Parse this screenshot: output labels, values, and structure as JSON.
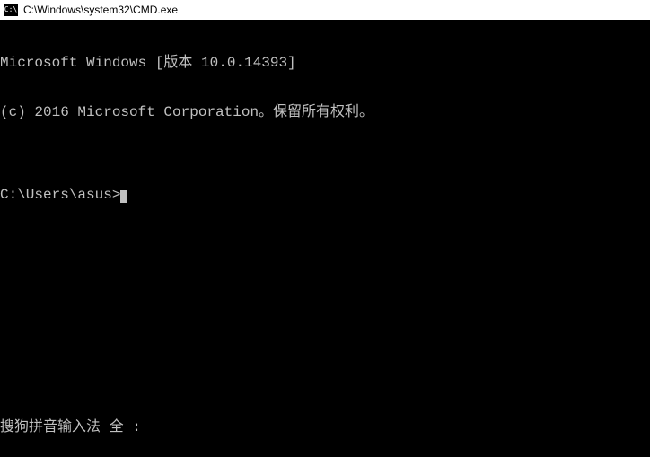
{
  "window": {
    "icon_label": "C:\\",
    "title": "C:\\Windows\\system32\\CMD.exe"
  },
  "terminal": {
    "line1": "Microsoft Windows [版本 10.0.14393]",
    "line2": "(c) 2016 Microsoft Corporation。保留所有权利。",
    "blank": "",
    "prompt": "C:\\Users\\asus>"
  },
  "ime": {
    "status": "搜狗拼音输入法 全 :"
  }
}
